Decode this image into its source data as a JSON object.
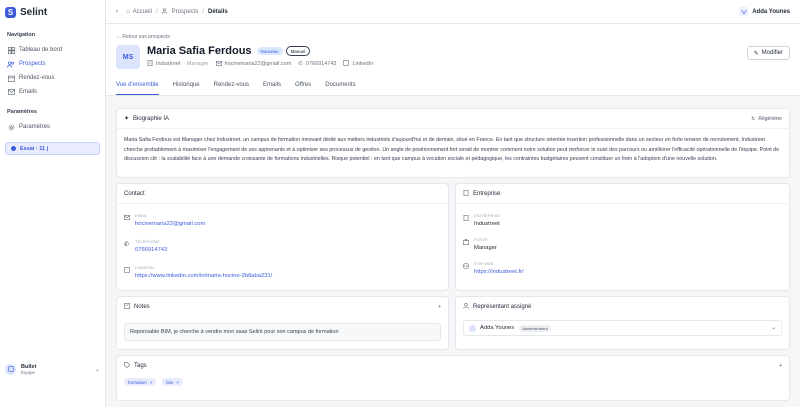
{
  "app": {
    "name": "Selint",
    "logo_letter": "S"
  },
  "sidebar": {
    "nav_title": "Navigation",
    "nav_items": [
      {
        "label": "Tableau de bord",
        "icon": "dashboard-icon",
        "active": false
      },
      {
        "label": "Prospects",
        "icon": "users-icon",
        "active": true
      },
      {
        "label": "Rendez-vous",
        "icon": "calendar-icon",
        "active": false
      },
      {
        "label": "Emails",
        "icon": "mail-icon",
        "active": false
      }
    ],
    "params_title": "Paramètres",
    "params_items": [
      {
        "label": "Paramètres",
        "icon": "gear-icon"
      }
    ],
    "trial_label": "Essai · 11 j",
    "user": {
      "name": "Bullet",
      "team": "Équipe"
    }
  },
  "topbar": {
    "crumbs": [
      "Accueil",
      "Prospects",
      "Détails"
    ],
    "user_name": "Adda Younes"
  },
  "prospect": {
    "back_label": "← Retour aux prospects",
    "initials": "MS",
    "name": "Maria Safia Ferdous",
    "status_badge": "Nouveau",
    "source_badge": "Manuel",
    "company": "Industreet",
    "role_sep": "· Manager",
    "email": "hocinemaria22@gmail.com",
    "phone": "0766914743",
    "linkedin_label": "LinkedIn",
    "modify_label": "Modifier"
  },
  "tabs": [
    "Vue d'ensemble",
    "Historique",
    "Rendez-vous",
    "Emails",
    "Offres",
    "Documents"
  ],
  "bio": {
    "title": "Biographie IA",
    "regen_label": "Régénérer",
    "text": "Maria Safia Ferdous est Manager chez Industreet, un campus de formation innovant dédié aux métiers industriels d'aujourd'hui et de demain, situé en France. En tant que structure orientée insertion professionnelle dans un secteur en forte tension de recrutement, Industreet cherche probablement à maximiser l'engagement de ses apprenants et à optimiser ses processus de gestion. Un angle de positionnement fort serait de montrer comment notre solution peut renforcer le suivi des parcours ou améliorer l'efficacité opérationnelle de l'équipe. Point de discussion clé : la scalabilité face à une demande croissante de formations industrielles. Risque potentiel : en tant que campus à vocation sociale et pédagogique, les contraintes budgétaires peuvent constituer un frein à l'adoption d'une nouvelle solution."
  },
  "contact": {
    "title": "Contact",
    "email_label": "EMAIL",
    "email": "hocinemaria22@gmail.com",
    "phone_label": "TÉLÉPHONE",
    "phone": "0766914743",
    "linkedin_label": "LINKEDIN",
    "linkedin": "https://www.linkedin.com/in/maria-hocine-2b8aba231/"
  },
  "company": {
    "title": "Entreprise",
    "name_label": "ENTREPRISE",
    "name": "Industreet",
    "post_label": "POSTE",
    "post": "Manager",
    "site_label": "SITE WEB",
    "site": "https://industreet.fr/"
  },
  "notes": {
    "title": "Notes",
    "text": "Reponsable BIM, je cherche à vendre mon saas Selint pour son campus de formation"
  },
  "rep": {
    "title": "Représentant assigné",
    "name": "Adda Younes",
    "role": "Administrateur"
  },
  "tags": {
    "title": "Tags",
    "items": [
      "formation",
      "bim"
    ]
  }
}
